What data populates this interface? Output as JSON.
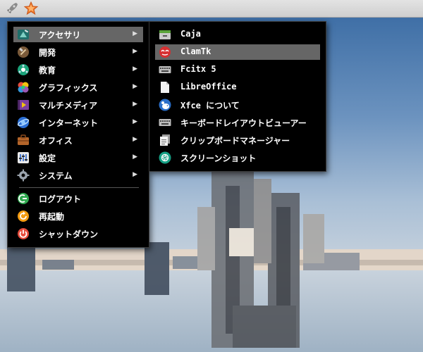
{
  "main_menu": {
    "items": [
      {
        "label": "アクセサリ",
        "icon": "accessories-icon",
        "has_submenu": true,
        "highlighted": true
      },
      {
        "label": "開発",
        "icon": "development-icon",
        "has_submenu": true
      },
      {
        "label": "教育",
        "icon": "education-icon",
        "has_submenu": true
      },
      {
        "label": "グラフィックス",
        "icon": "graphics-icon",
        "has_submenu": true
      },
      {
        "label": "マルチメディア",
        "icon": "multimedia-icon",
        "has_submenu": true
      },
      {
        "label": "インターネット",
        "icon": "internet-icon",
        "has_submenu": true
      },
      {
        "label": "オフィス",
        "icon": "office-icon",
        "has_submenu": true
      },
      {
        "label": "設定",
        "icon": "settings-icon",
        "has_submenu": true
      },
      {
        "label": "システム",
        "icon": "system-icon",
        "has_submenu": true
      }
    ],
    "session_items": [
      {
        "label": "ログアウト",
        "icon": "logout-icon"
      },
      {
        "label": "再起動",
        "icon": "reboot-icon"
      },
      {
        "label": "シャットダウン",
        "icon": "shutdown-icon"
      }
    ],
    "arrow_glyph": "▶"
  },
  "submenu": {
    "items": [
      {
        "label": "Caja",
        "icon": "file-manager-icon"
      },
      {
        "label": "ClamTk",
        "icon": "clamtk-icon",
        "highlighted": true
      },
      {
        "label": "Fcitx 5",
        "icon": "keyboard-icon"
      },
      {
        "label": "LibreOffice",
        "icon": "document-icon"
      },
      {
        "label": "Xfce について",
        "icon": "xfce-mouse-icon"
      },
      {
        "label": "キーボードレイアウトビューアー",
        "icon": "keyboard-icon"
      },
      {
        "label": "クリップボードマネージャー",
        "icon": "clipboard-icon"
      },
      {
        "label": "スクリーンショット",
        "icon": "screenshot-icon"
      }
    ]
  },
  "colors": {
    "menu_bg": "#000000",
    "highlight": "#666666",
    "text": "#ffffff",
    "panel": "#d9d9d9"
  }
}
